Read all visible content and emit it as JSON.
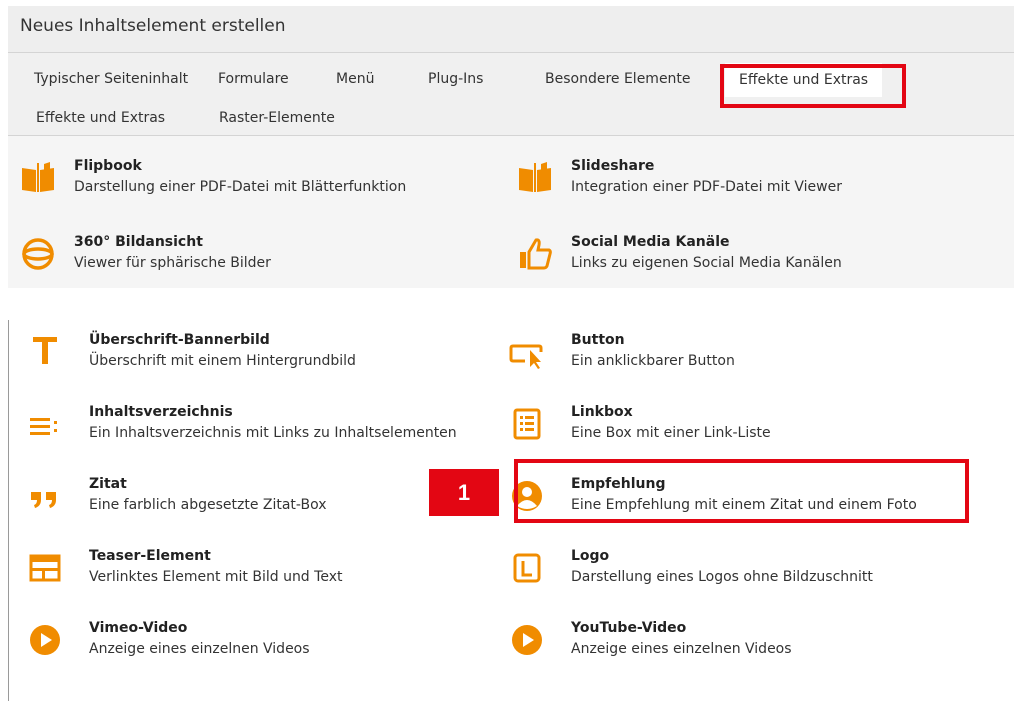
{
  "header": {
    "title": "Neues Inhaltselement erstellen"
  },
  "tabs": [
    {
      "label": "Typischer Seiteninhalt"
    },
    {
      "label": "Formulare"
    },
    {
      "label": "Menü"
    },
    {
      "label": "Plug-Ins"
    },
    {
      "label": "Besondere Elemente"
    },
    {
      "label": "Effekte und Extras",
      "active": true
    },
    {
      "label": "Effekte und Extras"
    },
    {
      "label": "Raster-Elemente"
    }
  ],
  "top_items": [
    {
      "title": "Flipbook",
      "desc": "Darstellung einer PDF-Datei mit Blätterfunktion",
      "icon": "book-icon"
    },
    {
      "title": "Slideshare",
      "desc": "Integration einer PDF-Datei mit Viewer",
      "icon": "book-icon"
    },
    {
      "title": "360° Bildansicht",
      "desc": "Viewer für sphärische Bilder",
      "icon": "sphere-icon"
    },
    {
      "title": "Social Media Kanäle",
      "desc": "Links zu eigenen Social Media Kanälen",
      "icon": "thumbs-up-icon"
    }
  ],
  "bottom_items": [
    {
      "title": "Überschrift-Bannerbild",
      "desc": "Überschrift mit einem Hintergrundbild",
      "icon": "text-t-icon"
    },
    {
      "title": "Button",
      "desc": "Ein anklickbarer Button",
      "icon": "button-cursor-icon"
    },
    {
      "title": "Inhaltsverzeichnis",
      "desc": "Ein Inhaltsverzeichnis mit Links zu Inhaltselementen",
      "icon": "list-lines-icon"
    },
    {
      "title": "Linkbox",
      "desc": "Eine Box mit einer Link-Liste",
      "icon": "list-box-icon"
    },
    {
      "title": "Zitat",
      "desc": "Eine farblich abgesetzte Zitat-Box",
      "icon": "quote-icon"
    },
    {
      "title": "Empfehlung",
      "desc": "Eine Empfehlung mit einem Zitat und einem Foto",
      "icon": "user-circle-icon"
    },
    {
      "title": "Teaser-Element",
      "desc": "Verlinktes Element mit Bild und Text",
      "icon": "teaser-layout-icon"
    },
    {
      "title": "Logo",
      "desc": "Darstellung eines Logos ohne Bildzuschnitt",
      "icon": "logo-l-icon"
    },
    {
      "title": "Vimeo-Video",
      "desc": "Anzeige eines einzelnen Videos",
      "icon": "play-icon"
    },
    {
      "title": "YouTube-Video",
      "desc": "Anzeige eines einzelnen Videos",
      "icon": "play-icon"
    }
  ],
  "annotation": {
    "badge_label": "1"
  },
  "colors": {
    "accent": "#f08c00",
    "highlight": "#e30613"
  }
}
